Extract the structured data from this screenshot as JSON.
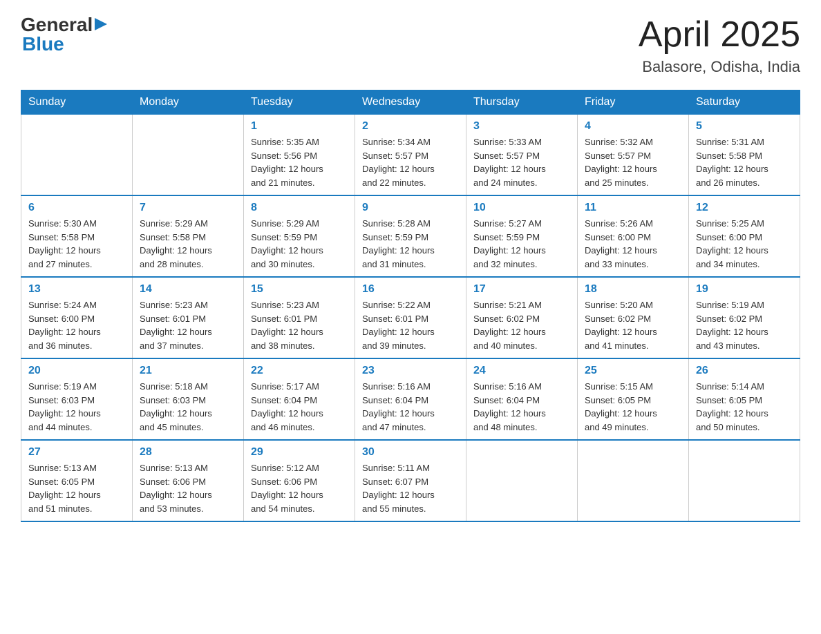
{
  "header": {
    "logo_general": "General",
    "logo_blue": "Blue",
    "title": "April 2025",
    "location": "Balasore, Odisha, India"
  },
  "days_of_week": [
    "Sunday",
    "Monday",
    "Tuesday",
    "Wednesday",
    "Thursday",
    "Friday",
    "Saturday"
  ],
  "weeks": [
    [
      {
        "day": "",
        "info": ""
      },
      {
        "day": "",
        "info": ""
      },
      {
        "day": "1",
        "info": "Sunrise: 5:35 AM\nSunset: 5:56 PM\nDaylight: 12 hours\nand 21 minutes."
      },
      {
        "day": "2",
        "info": "Sunrise: 5:34 AM\nSunset: 5:57 PM\nDaylight: 12 hours\nand 22 minutes."
      },
      {
        "day": "3",
        "info": "Sunrise: 5:33 AM\nSunset: 5:57 PM\nDaylight: 12 hours\nand 24 minutes."
      },
      {
        "day": "4",
        "info": "Sunrise: 5:32 AM\nSunset: 5:57 PM\nDaylight: 12 hours\nand 25 minutes."
      },
      {
        "day": "5",
        "info": "Sunrise: 5:31 AM\nSunset: 5:58 PM\nDaylight: 12 hours\nand 26 minutes."
      }
    ],
    [
      {
        "day": "6",
        "info": "Sunrise: 5:30 AM\nSunset: 5:58 PM\nDaylight: 12 hours\nand 27 minutes."
      },
      {
        "day": "7",
        "info": "Sunrise: 5:29 AM\nSunset: 5:58 PM\nDaylight: 12 hours\nand 28 minutes."
      },
      {
        "day": "8",
        "info": "Sunrise: 5:29 AM\nSunset: 5:59 PM\nDaylight: 12 hours\nand 30 minutes."
      },
      {
        "day": "9",
        "info": "Sunrise: 5:28 AM\nSunset: 5:59 PM\nDaylight: 12 hours\nand 31 minutes."
      },
      {
        "day": "10",
        "info": "Sunrise: 5:27 AM\nSunset: 5:59 PM\nDaylight: 12 hours\nand 32 minutes."
      },
      {
        "day": "11",
        "info": "Sunrise: 5:26 AM\nSunset: 6:00 PM\nDaylight: 12 hours\nand 33 minutes."
      },
      {
        "day": "12",
        "info": "Sunrise: 5:25 AM\nSunset: 6:00 PM\nDaylight: 12 hours\nand 34 minutes."
      }
    ],
    [
      {
        "day": "13",
        "info": "Sunrise: 5:24 AM\nSunset: 6:00 PM\nDaylight: 12 hours\nand 36 minutes."
      },
      {
        "day": "14",
        "info": "Sunrise: 5:23 AM\nSunset: 6:01 PM\nDaylight: 12 hours\nand 37 minutes."
      },
      {
        "day": "15",
        "info": "Sunrise: 5:23 AM\nSunset: 6:01 PM\nDaylight: 12 hours\nand 38 minutes."
      },
      {
        "day": "16",
        "info": "Sunrise: 5:22 AM\nSunset: 6:01 PM\nDaylight: 12 hours\nand 39 minutes."
      },
      {
        "day": "17",
        "info": "Sunrise: 5:21 AM\nSunset: 6:02 PM\nDaylight: 12 hours\nand 40 minutes."
      },
      {
        "day": "18",
        "info": "Sunrise: 5:20 AM\nSunset: 6:02 PM\nDaylight: 12 hours\nand 41 minutes."
      },
      {
        "day": "19",
        "info": "Sunrise: 5:19 AM\nSunset: 6:02 PM\nDaylight: 12 hours\nand 43 minutes."
      }
    ],
    [
      {
        "day": "20",
        "info": "Sunrise: 5:19 AM\nSunset: 6:03 PM\nDaylight: 12 hours\nand 44 minutes."
      },
      {
        "day": "21",
        "info": "Sunrise: 5:18 AM\nSunset: 6:03 PM\nDaylight: 12 hours\nand 45 minutes."
      },
      {
        "day": "22",
        "info": "Sunrise: 5:17 AM\nSunset: 6:04 PM\nDaylight: 12 hours\nand 46 minutes."
      },
      {
        "day": "23",
        "info": "Sunrise: 5:16 AM\nSunset: 6:04 PM\nDaylight: 12 hours\nand 47 minutes."
      },
      {
        "day": "24",
        "info": "Sunrise: 5:16 AM\nSunset: 6:04 PM\nDaylight: 12 hours\nand 48 minutes."
      },
      {
        "day": "25",
        "info": "Sunrise: 5:15 AM\nSunset: 6:05 PM\nDaylight: 12 hours\nand 49 minutes."
      },
      {
        "day": "26",
        "info": "Sunrise: 5:14 AM\nSunset: 6:05 PM\nDaylight: 12 hours\nand 50 minutes."
      }
    ],
    [
      {
        "day": "27",
        "info": "Sunrise: 5:13 AM\nSunset: 6:05 PM\nDaylight: 12 hours\nand 51 minutes."
      },
      {
        "day": "28",
        "info": "Sunrise: 5:13 AM\nSunset: 6:06 PM\nDaylight: 12 hours\nand 53 minutes."
      },
      {
        "day": "29",
        "info": "Sunrise: 5:12 AM\nSunset: 6:06 PM\nDaylight: 12 hours\nand 54 minutes."
      },
      {
        "day": "30",
        "info": "Sunrise: 5:11 AM\nSunset: 6:07 PM\nDaylight: 12 hours\nand 55 minutes."
      },
      {
        "day": "",
        "info": ""
      },
      {
        "day": "",
        "info": ""
      },
      {
        "day": "",
        "info": ""
      }
    ]
  ]
}
